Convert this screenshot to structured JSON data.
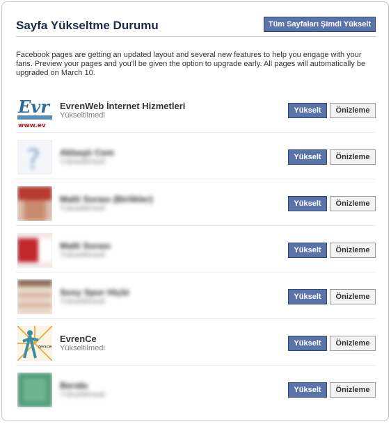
{
  "header": {
    "title": "Sayfa Yükseltme Durumu",
    "upgrade_all_label": "Tüm Sayfaları Şimdi Yükselt"
  },
  "intro": "Facebook pages are getting an updated layout and several new features to help you engage with your fans. Preview your pages and you'll be given the option to upgrade early. All pages will automatically be upgraded on March 10.",
  "pages": [
    {
      "name": "EvrenWeb İnternet Hizmetleri",
      "status": "Yükseltilmedi",
      "blurred": false,
      "thumb": "evrenweb-logo"
    },
    {
      "name": "Akbaşlı Cem",
      "status": "Yükseltilmedi",
      "blurred": true,
      "thumb": "question-mark"
    },
    {
      "name": "Malti Sorası (Birlikler)",
      "status": "Yükseltilmedi",
      "blurred": true,
      "thumb": "red-photo"
    },
    {
      "name": "Malti Sorası",
      "status": "Yükseltilmedi",
      "blurred": true,
      "thumb": "red-white-photo"
    },
    {
      "name": "Sosy Spor Hiçbi",
      "status": "Yükseltilmedi",
      "blurred": true,
      "thumb": "striped-photo"
    },
    {
      "name": "EvrenCe",
      "status": "Yükseltilmedi",
      "blurred": false,
      "thumb": "evrence-figure"
    },
    {
      "name": "Berabı",
      "status": "Yükseltilmedi",
      "blurred": true,
      "thumb": "green-photo"
    }
  ],
  "row_actions": {
    "upgrade_label": "Yükselt",
    "preview_label": "Önizleme"
  },
  "colors": {
    "primary_button": "#5b74a8",
    "primary_border": "#29447e",
    "title": "#1c2a47"
  }
}
